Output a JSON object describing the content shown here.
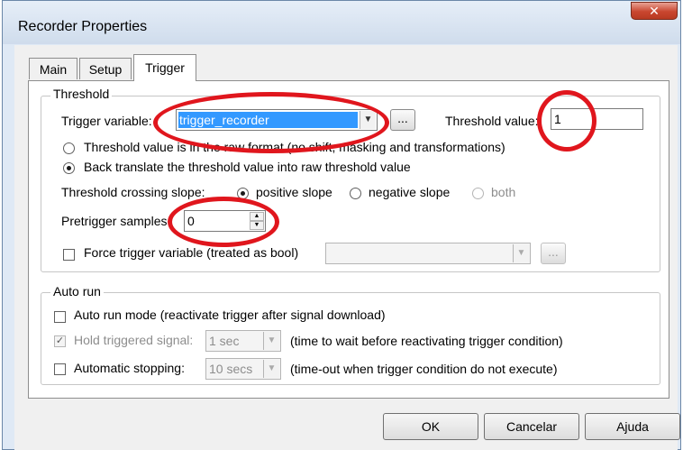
{
  "window": {
    "title": "Recorder Properties",
    "close_glyph": "✕"
  },
  "tabs": [
    {
      "label": "Main",
      "active": false
    },
    {
      "label": "Setup",
      "active": false
    },
    {
      "label": "Trigger",
      "active": true
    }
  ],
  "threshold": {
    "group_label": "Threshold",
    "trigger_variable_label": "Trigger variable:",
    "trigger_variable_value": "trigger_recorder",
    "browse_label": "...",
    "threshold_value_label": "Threshold value:",
    "threshold_value": "1",
    "radio_raw_label": "Threshold value is in the raw format (no shift, masking and transformations)",
    "radio_back_label": "Back translate the threshold value into raw threshold value",
    "slope_label": "Threshold crossing slope:",
    "slope_positive": "positive slope",
    "slope_negative": "negative slope",
    "slope_both": "both",
    "pretrigger_label": "Pretrigger samples:",
    "pretrigger_value": "0",
    "force_trigger_label": "Force trigger variable (treated as bool)",
    "force_browse_label": "..."
  },
  "auto_run": {
    "group_label": "Auto run",
    "auto_run_mode_label": "Auto run mode (reactivate trigger after signal download)",
    "hold_label": "Hold triggered signal:",
    "hold_value": "1 sec",
    "hold_hint": "(time to wait before reactivating trigger condition)",
    "auto_stop_label": "Automatic stopping:",
    "auto_stop_value": "10 secs",
    "auto_stop_hint": "(time-out when trigger condition do not execute)"
  },
  "buttons": {
    "ok": "OK",
    "cancel": "Cancelar",
    "help": "Ajuda"
  },
  "colors": {
    "annotation": "#e0161d",
    "selection": "#3399ff"
  }
}
